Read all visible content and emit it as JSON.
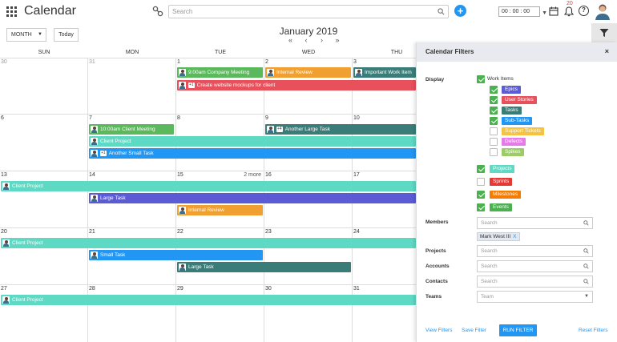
{
  "header": {
    "app_title": "Calendar",
    "search_placeholder": "Search",
    "add_label": "+",
    "timer": "00 : 00 : 00",
    "notification_count": "20",
    "help_label": "?"
  },
  "toolbar": {
    "view_select": "MONTH",
    "today_label": "Today",
    "period_title": "January 2019",
    "nav": [
      "«",
      "‹",
      "›",
      "»"
    ]
  },
  "weekdays": [
    "SUN",
    "MON",
    "TUE",
    "WED",
    "THU"
  ],
  "weeks": [
    {
      "days": [
        "30",
        "31",
        "1",
        "2",
        "3"
      ],
      "muted": [
        true,
        true,
        false,
        false,
        false
      ],
      "more": ""
    },
    {
      "days": [
        "6",
        "7",
        "8",
        "9",
        "10"
      ],
      "muted": [
        false,
        false,
        false,
        false,
        false
      ],
      "more": ""
    },
    {
      "days": [
        "13",
        "14",
        "15",
        "16",
        "17"
      ],
      "muted": [
        false,
        false,
        false,
        false,
        false
      ],
      "more": "2 more"
    },
    {
      "days": [
        "20",
        "21",
        "22",
        "23",
        "24"
      ],
      "muted": [
        false,
        false,
        false,
        false,
        false
      ],
      "more": ""
    },
    {
      "days": [
        "27",
        "28",
        "29",
        "30",
        "31"
      ],
      "muted": [
        false,
        false,
        false,
        false,
        false
      ],
      "more": ""
    }
  ],
  "events": [
    {
      "label": "9:00am Company Meeting",
      "color": "#5cb85c",
      "plus": ""
    },
    {
      "label": "Internal Review",
      "color": "#f0a030",
      "plus": ""
    },
    {
      "label": "Important Work Item",
      "color": "#3a7d78",
      "plus": ""
    },
    {
      "label": "Create website mockups for client",
      "color": "#e8505b",
      "plus": "+1"
    },
    {
      "label": "10:00am Client Meeting",
      "color": "#5cb85c",
      "plus": ""
    },
    {
      "label": "Another Large Task",
      "color": "#3a7d78",
      "plus": "+4"
    },
    {
      "label": "Client Project",
      "color": "#5dd9c4",
      "plus": ""
    },
    {
      "label": "Another Small Task",
      "color": "#2196f3",
      "plus": "+1"
    },
    {
      "label": "Client Project",
      "color": "#5dd9c4",
      "plus": ""
    },
    {
      "label": "Large Task",
      "color": "#5b5bd6",
      "plus": ""
    },
    {
      "label": "Internal Review",
      "color": "#f0a030",
      "plus": ""
    },
    {
      "label": "Client Project",
      "color": "#5dd9c4",
      "plus": ""
    },
    {
      "label": "Small Task",
      "color": "#2196f3",
      "plus": ""
    },
    {
      "label": "Large Task",
      "color": "#3a7d78",
      "plus": ""
    },
    {
      "label": "Client Project",
      "color": "#5dd9c4",
      "plus": ""
    }
  ],
  "filters": {
    "title": "Calendar Filters",
    "close": "×",
    "display_label": "Display",
    "work_items_label": "Work Items",
    "work_items_checked": true,
    "sub_items": [
      {
        "label": "Epics",
        "color": "#5b5bd6",
        "checked": true
      },
      {
        "label": "User Stories",
        "color": "#e8505b",
        "checked": true
      },
      {
        "label": "Tasks",
        "color": "#3a7d78",
        "checked": true
      },
      {
        "label": "Sub-Tasks",
        "color": "#2196f3",
        "checked": true
      },
      {
        "label": "Support Tickets",
        "color": "#f5c342",
        "checked": false
      },
      {
        "label": "Defects",
        "color": "#e57be8",
        "checked": false
      },
      {
        "label": "Spikes",
        "color": "#9ccc65",
        "checked": false
      }
    ],
    "other_items": [
      {
        "label": "Projects",
        "color": "#5dd9c4",
        "checked": true
      },
      {
        "label": "Sprints",
        "color": "#e53935",
        "checked": false
      },
      {
        "label": "Milestones",
        "color": "#f57c00",
        "checked": true
      },
      {
        "label": "Events",
        "color": "#4caf50",
        "checked": true
      }
    ],
    "members_label": "Members",
    "members_placeholder": "Search",
    "member_chip": "Mark West III",
    "member_chip_remove": "X",
    "projects_label": "Projects",
    "projects_placeholder": "Search",
    "accounts_label": "Accounts",
    "accounts_placeholder": "Search",
    "contacts_label": "Contacts",
    "contacts_placeholder": "Search",
    "teams_label": "Teams",
    "teams_placeholder": "Team",
    "view_filters": "View Filters",
    "save_filter": "Save Filter",
    "run_filter": "RUN FILTER",
    "reset_filters": "Reset Filters"
  }
}
